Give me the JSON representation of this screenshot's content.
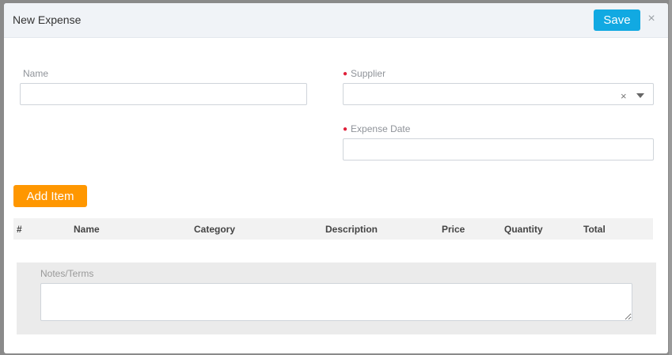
{
  "modal": {
    "title": "New Expense",
    "save_label": "Save",
    "close_glyph": "×"
  },
  "form": {
    "name_label": "Name",
    "name_value": "",
    "supplier_label": "Supplier",
    "supplier_value": "",
    "supplier_clear_glyph": "×",
    "expense_date_label": "Expense Date",
    "expense_date_value": "",
    "required_marker": "●",
    "required_color": "#e0213b"
  },
  "items": {
    "add_label": "Add Item",
    "columns": [
      "#",
      "Name",
      "Category",
      "Description",
      "Price",
      "Quantity",
      "Total"
    ]
  },
  "notes": {
    "label": "Notes/Terms",
    "value": ""
  },
  "colors": {
    "save_button": "#11a9e2",
    "add_button": "#ff9700"
  },
  "icons": {
    "close": "close-icon",
    "clear": "clear-icon",
    "dropdown": "chevron-down-icon",
    "resize": "resize-grip-icon"
  }
}
